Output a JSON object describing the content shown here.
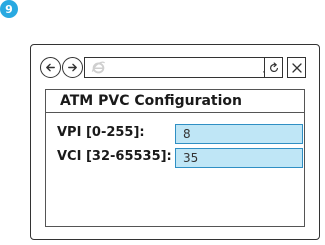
{
  "step": {
    "number": "9"
  },
  "browser": {
    "icons": {
      "back": "arrow-left-circle-icon",
      "forward": "arrow-right-circle-icon",
      "ie": "internet-explorer-icon",
      "search": "search-icon",
      "refresh": "refresh-icon",
      "close": "close-icon"
    }
  },
  "panel": {
    "title": "ATM PVC Configuration",
    "fields": [
      {
        "label": "VPI [0-255]:",
        "value": "8"
      },
      {
        "label": "VCI [32-65535]:",
        "value": "35"
      }
    ]
  },
  "colors": {
    "step_badge": "#29a9e1",
    "input_fill": "#bfe6f6",
    "input_border": "#2f8fc4"
  }
}
